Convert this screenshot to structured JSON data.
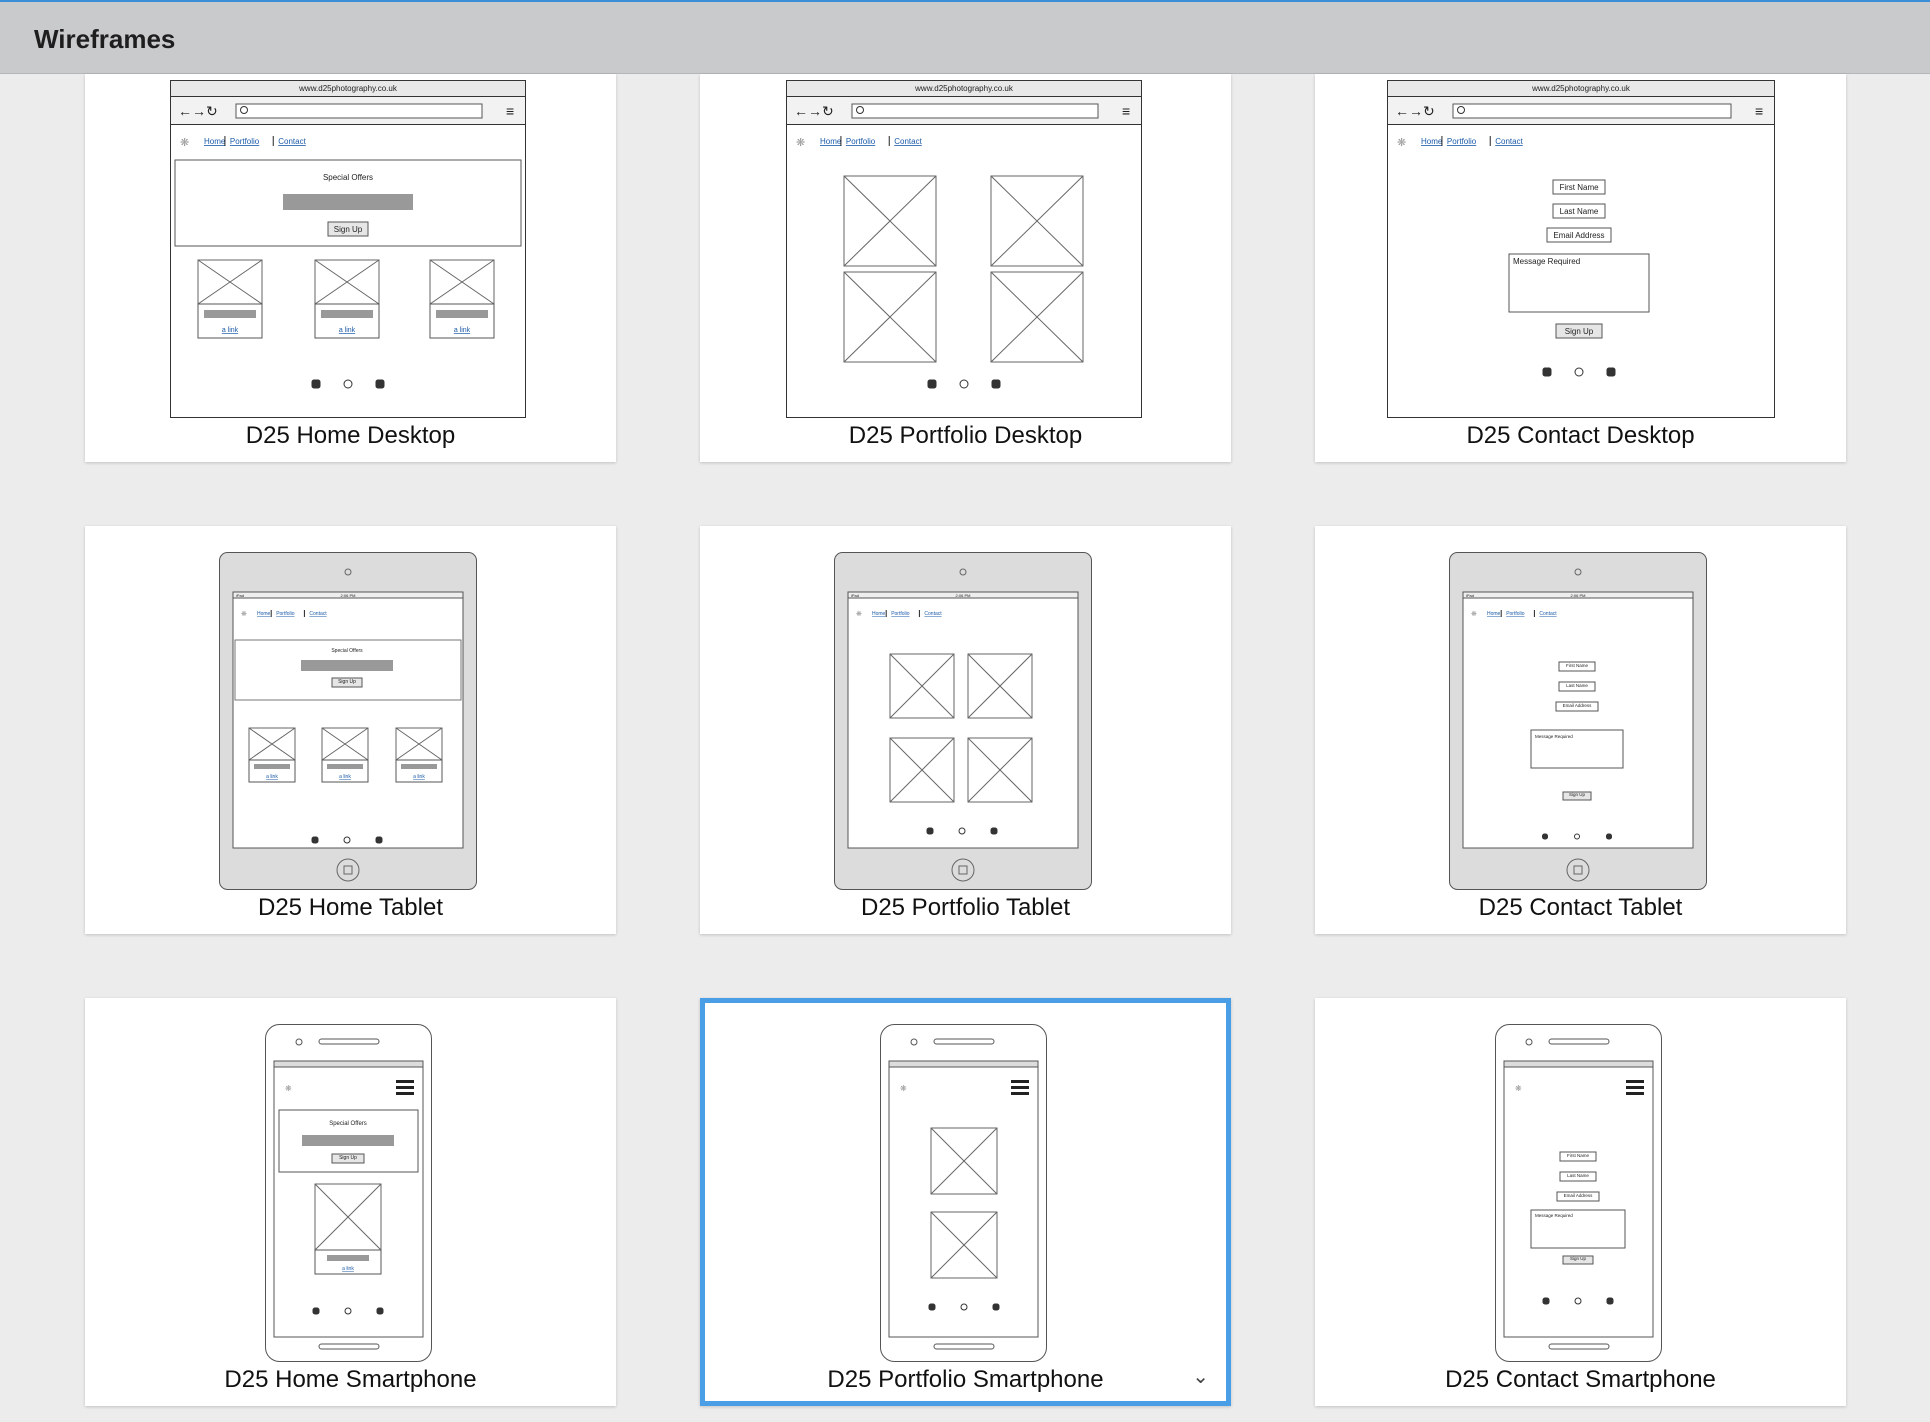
{
  "app": {
    "title": "Wireframes",
    "accent": "#4a9ee6"
  },
  "wire": {
    "url": "www.d25photography.co.uk",
    "nav": [
      "Home",
      "Portfolio",
      "Contact"
    ],
    "special_offers": "Special Offers",
    "sign_up": "Sign Up",
    "link": "a link",
    "first_name": "First Name",
    "last_name": "Last Name",
    "email": "Email Address",
    "message": "Message Required",
    "status_device": "iPad",
    "status_time": "2:06 PM"
  },
  "cards": [
    {
      "label": "D25 Home Desktop",
      "type": "desktop-home",
      "selected": false
    },
    {
      "label": "D25 Portfolio Desktop",
      "type": "desktop-portfolio",
      "selected": false
    },
    {
      "label": "D25 Contact Desktop",
      "type": "desktop-contact",
      "selected": false
    },
    {
      "label": "D25 Home Tablet",
      "type": "tablet-home",
      "selected": false
    },
    {
      "label": "D25 Portfolio Tablet",
      "type": "tablet-portfolio",
      "selected": false
    },
    {
      "label": "D25 Contact Tablet",
      "type": "tablet-contact",
      "selected": false
    },
    {
      "label": "D25 Home Smartphone",
      "type": "phone-home",
      "selected": false
    },
    {
      "label": "D25 Portfolio Smartphone",
      "type": "phone-portfolio",
      "selected": true
    },
    {
      "label": "D25 Contact Smartphone",
      "type": "phone-contact",
      "selected": false
    }
  ]
}
